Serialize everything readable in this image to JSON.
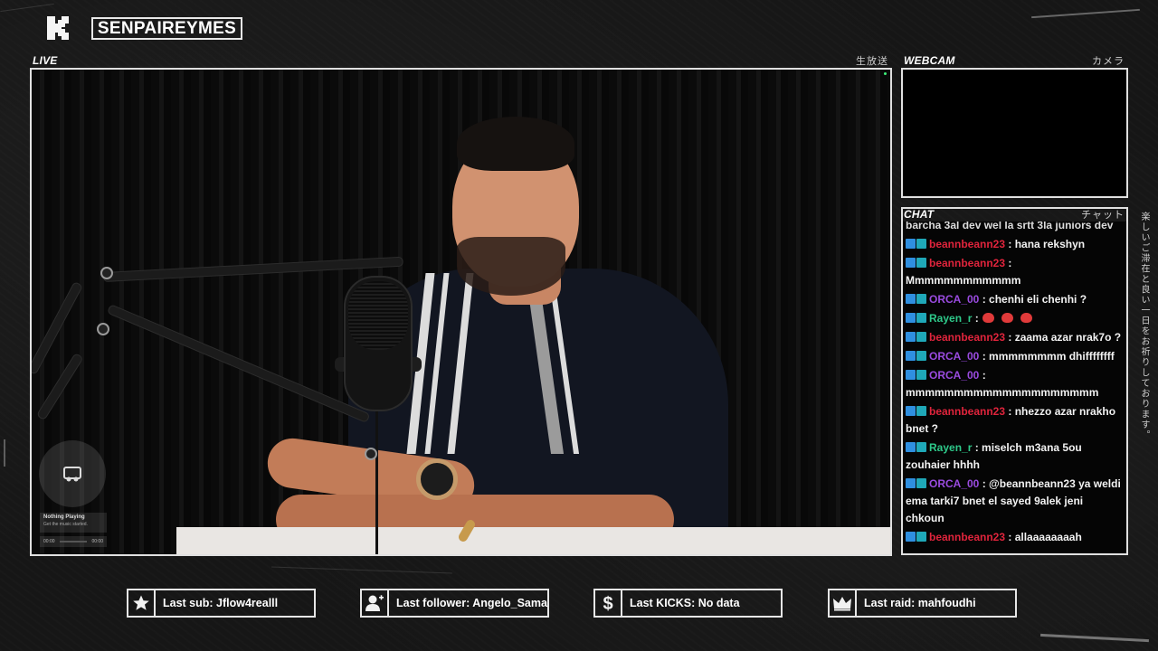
{
  "header": {
    "channel_name": "SENPAIREYMES"
  },
  "live_panel": {
    "title": "LIVE",
    "jp_label": "生放送"
  },
  "webcam_panel": {
    "title": "WEBCAM",
    "jp_label": "カメラ"
  },
  "chat_panel": {
    "title": "CHAT",
    "jp_label": "チャット",
    "cut_message": "barcha 3al dev wel la srtt 3la juniors dev",
    "messages": [
      {
        "user": "beannbeann23",
        "color": "#e0243c",
        "text": ": hana rekshyn"
      },
      {
        "user": "beannbeann23",
        "color": "#e0243c",
        "text": ": Mmmmmmmmmmmm"
      },
      {
        "user": "ORCA_00",
        "color": "#9a4be0",
        "text": ": chenhi eli chenhi ?"
      },
      {
        "user": "Rayen_r",
        "color": "#2ec98a",
        "text": ":"
      },
      {
        "user": "beannbeann23",
        "color": "#e0243c",
        "text": ": zaama azar nrak7o ?"
      },
      {
        "user": "ORCA_00",
        "color": "#9a4be0",
        "text": ": mmmmmmmm dhiffffffff"
      },
      {
        "user": "ORCA_00",
        "color": "#9a4be0",
        "text": ": mmmmmmmmmmmmmmmmmmmm"
      },
      {
        "user": "beannbeann23",
        "color": "#e0243c",
        "text": ": nhezzo azar nrakho bnet ?"
      },
      {
        "user": "Rayen_r",
        "color": "#2ec98a",
        "text": ": miselch m3ana 5ou zouhaier hhhh"
      },
      {
        "user": "ORCA_00",
        "color": "#9a4be0",
        "text": ": @beannbeann23 ya weldi ema tarki7 bnet el sayed 9alek jeni chkoun"
      },
      {
        "user": "beannbeann23",
        "color": "#e0243c",
        "text": ": allaaaaaaaah"
      }
    ]
  },
  "music_player": {
    "title": "Nothing Playing",
    "subtitle": "Get the music started.",
    "time_start": "00:00",
    "time_end": "00:00"
  },
  "side_text": "楽しいご滞在と良い一日をお祈りしております。",
  "stats": [
    {
      "icon": "star-icon",
      "label": "Last sub: Jflow4realll"
    },
    {
      "icon": "add-user-icon",
      "label": "Last follower: Angelo_Sama"
    },
    {
      "icon": "dollar-icon",
      "label": "Last KICKS: No data"
    },
    {
      "icon": "crown-icon",
      "label": "Last raid: mahfoudhi"
    }
  ]
}
